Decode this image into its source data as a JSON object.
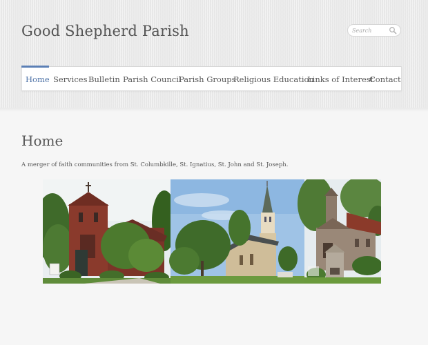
{
  "site": {
    "title": "Good Shepherd Parish"
  },
  "search": {
    "placeholder": "Search",
    "icon": "search-icon"
  },
  "nav": {
    "items": [
      {
        "label": "Home",
        "active": true
      },
      {
        "label": "Services",
        "active": false
      },
      {
        "label": "Bulletin",
        "active": false
      },
      {
        "label": "Parish Council",
        "active": false
      },
      {
        "label": "Parish Groups",
        "active": false
      },
      {
        "label": "Religious Education",
        "active": false
      },
      {
        "label": "Links of Interest",
        "active": false
      },
      {
        "label": "Contact",
        "active": false
      }
    ],
    "active_color": "#4a6fa5"
  },
  "main": {
    "page_title": "Home",
    "intro": "A merger of faith communities from St. Columbkille, St. Ignatius, St. John and St. Joseph."
  },
  "colors": {
    "accent": "#5b7fb5",
    "text": "#555555",
    "background": "#f6f6f6"
  }
}
